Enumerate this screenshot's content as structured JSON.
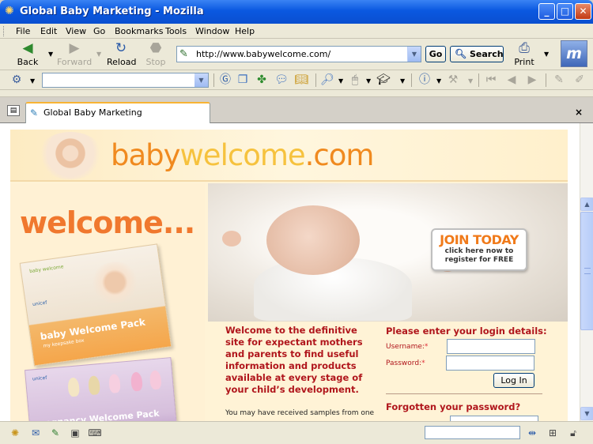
{
  "window": {
    "title": "Global Baby Marketing - Mozilla"
  },
  "menu": {
    "file": "File",
    "edit": "Edit",
    "view": "View",
    "go": "Go",
    "bookmarks": "Bookmarks",
    "tools": "Tools",
    "window": "Window",
    "help": "Help"
  },
  "nav": {
    "back": "Back",
    "forward": "Forward",
    "reload": "Reload",
    "stop": "Stop",
    "url": "http://www.babywelcome.com/",
    "go": "Go",
    "search": "Search",
    "print": "Print",
    "throbber": "m"
  },
  "tab": {
    "label": "Global Baby Marketing",
    "close": "×"
  },
  "site": {
    "brand_baby": "baby",
    "brand_welcome": "welcome",
    "brand_com": ".com",
    "welcome_heading": "welcome...",
    "pack_title": "baby Welcome Pack",
    "pack_subtitle": "my keepsake box",
    "pack_tag": "baby welcome",
    "pack_unicef": "unicef",
    "pack2_title": "pregnancy Welcome Pack",
    "pack2_unicef": "unicef",
    "join_big": "JOIN TODAY",
    "join_line1": "click here now to",
    "join_line2": "register for FREE",
    "intro": "Welcome to the definitive site for expectant mothers and parents to find useful information and products available at every stage of your child’s development.",
    "samples": "You may have received samples from one",
    "login_heading": "Please enter your login details:",
    "username_label": "Username:",
    "password_label": "Password:",
    "required": "*",
    "login_button": "Log In",
    "forgot_heading": "Forgotten your password?"
  },
  "colors": {
    "titlebar": "#0a58e0",
    "brand_orange": "#f08a1f",
    "brand_yellow": "#f6c23e",
    "heading_red": "#b0161c",
    "welcome_orange": "#f0782e"
  }
}
